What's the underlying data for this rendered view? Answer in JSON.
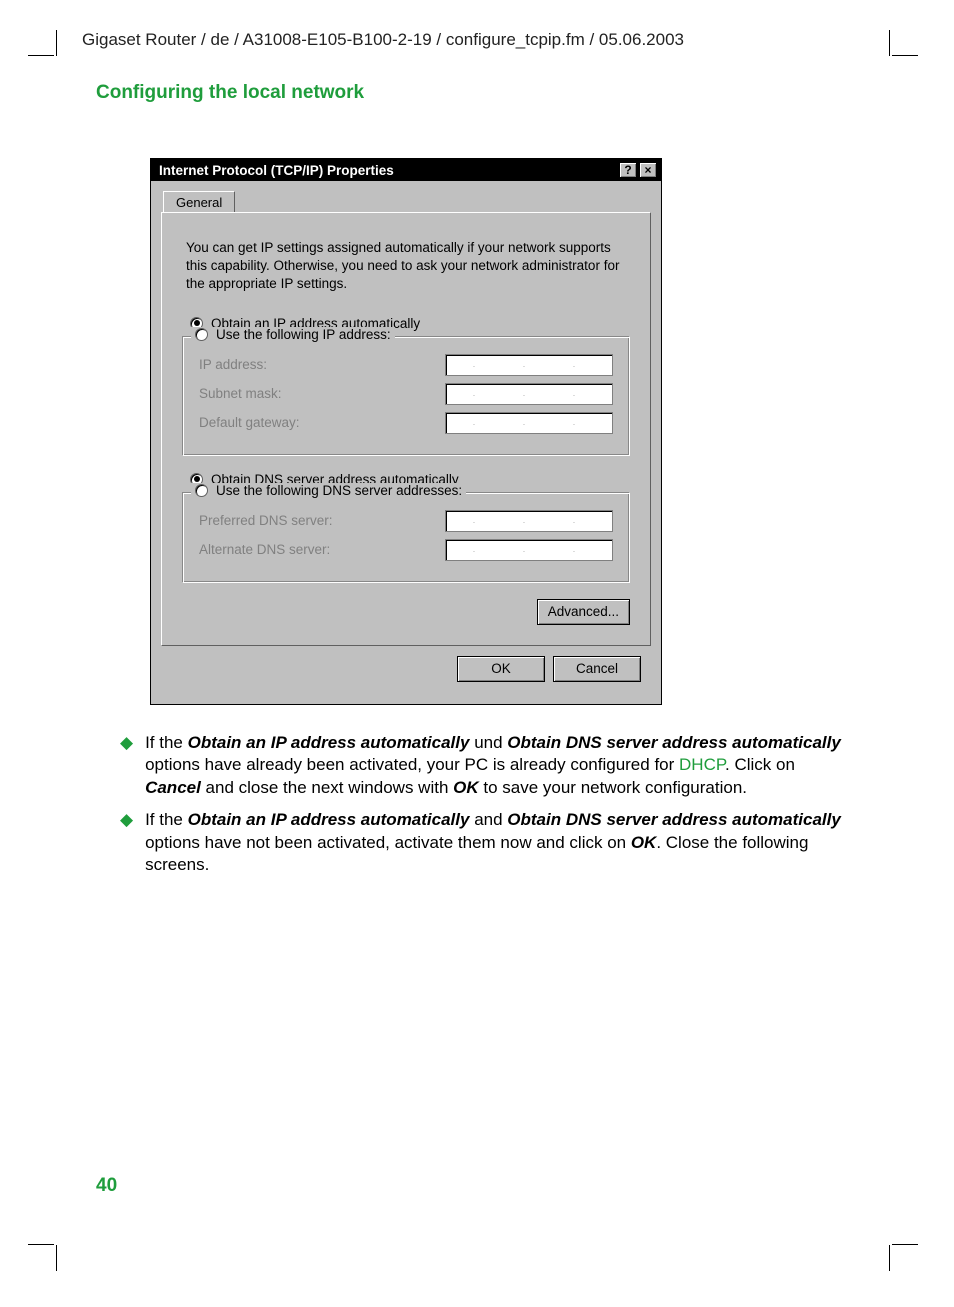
{
  "header_path": "Gigaset Router / de / A31008-E105-B100-2-19 / configure_tcpip.fm / 05.06.2003",
  "section_title": "Configuring the local network",
  "dialog": {
    "title": "Internet Protocol (TCP/IP) Properties",
    "help_glyph": "?",
    "close_glyph": "×",
    "tab_general": "General",
    "description": "You can get IP settings assigned automatically if your network supports this capability. Otherwise, you need to ask your network administrator for the appropriate IP settings.",
    "radio_obtain_ip": "Obtain an IP address automatically",
    "radio_use_ip": "Use the following IP address:",
    "label_ip_address": "IP address:",
    "label_subnet": "Subnet mask:",
    "label_gateway": "Default gateway:",
    "radio_obtain_dns": "Obtain DNS server address automatically",
    "radio_use_dns": "Use the following DNS server addresses:",
    "label_pref_dns": "Preferred DNS server:",
    "label_alt_dns": "Alternate DNS server:",
    "btn_advanced": "Advanced...",
    "btn_ok": "OK",
    "btn_cancel": "Cancel"
  },
  "bullets": {
    "b1_pre": "If the ",
    "b1_bold1": "Obtain an IP address automatically",
    "b1_mid1": " und ",
    "b1_bold2": "Obtain DNS server address automatically",
    "b1_mid2": "  options have already been activated, your PC is already configured for ",
    "b1_link": "DHCP",
    "b1_mid3": ". Click on ",
    "b1_bold3": "Cancel",
    "b1_mid4": " and close the next windows with ",
    "b1_bold4": "OK",
    "b1_end": " to save your network configuration.",
    "b2_pre": "If the ",
    "b2_bold1": "Obtain an IP address automatically",
    "b2_mid1": " and ",
    "b2_bold2": "Obtain DNS server address automatically",
    "b2_mid2": "  options have not been activated, activate them now and click on ",
    "b2_bold3": "OK",
    "b2_end": ". Close the following screens."
  },
  "page_number": "40"
}
